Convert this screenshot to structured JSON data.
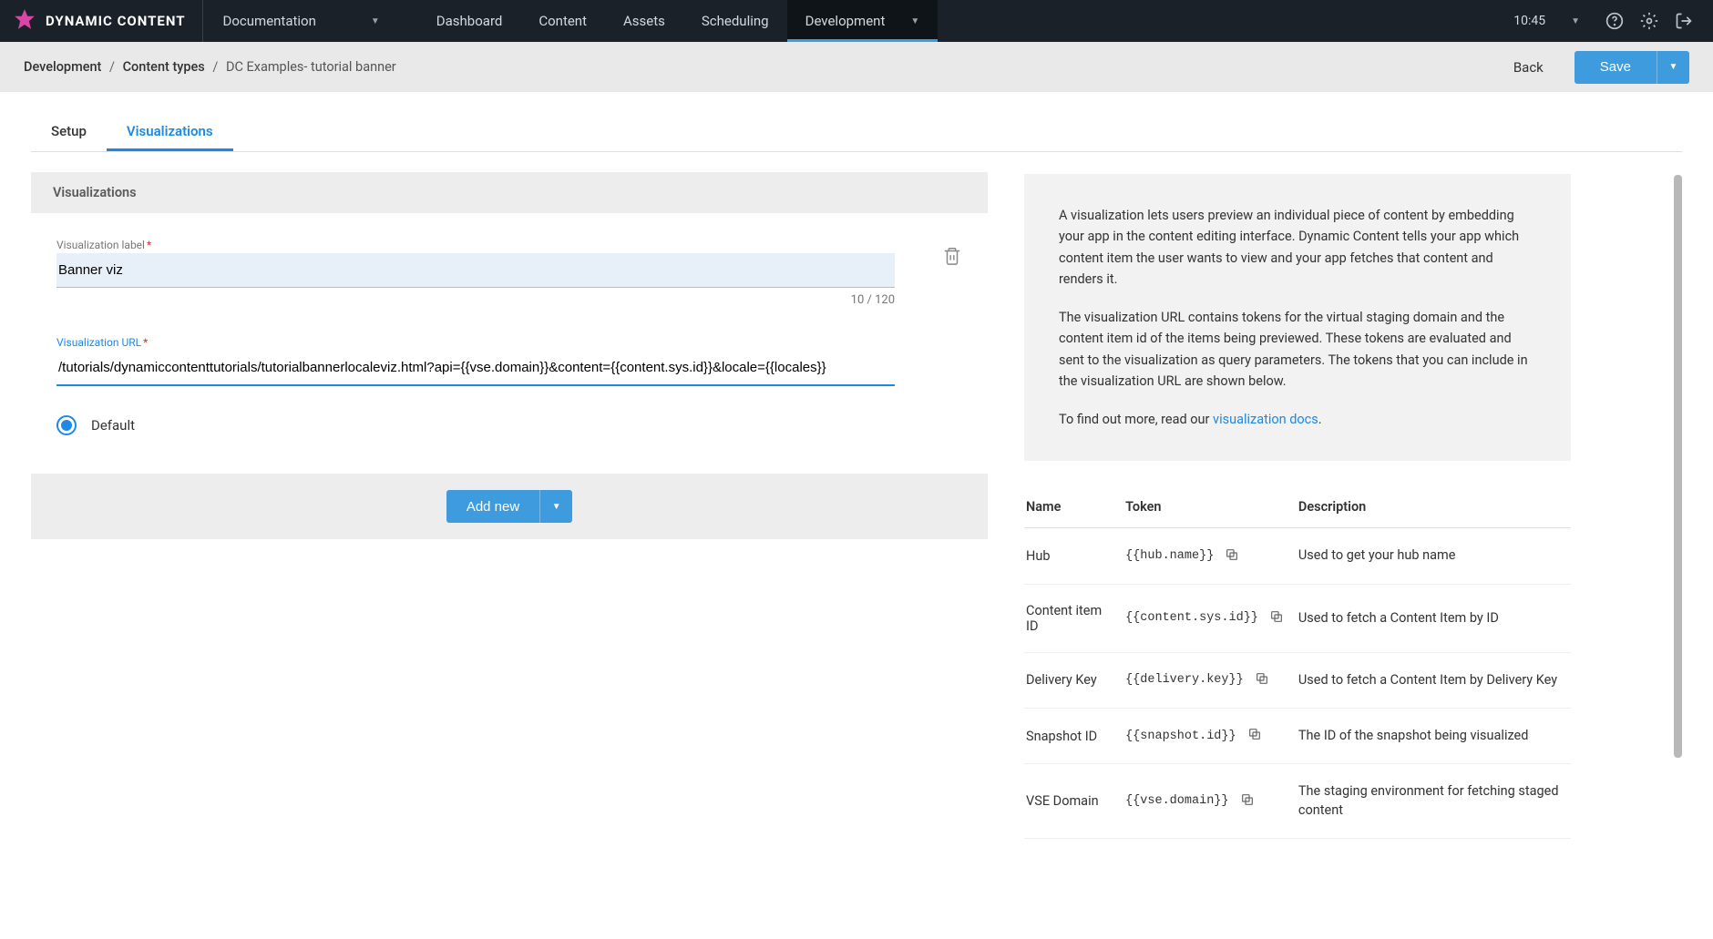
{
  "brand": "DYNAMIC CONTENT",
  "topnav": {
    "documentation_label": "Documentation",
    "tabs": [
      "Dashboard",
      "Content",
      "Assets",
      "Scheduling",
      "Development"
    ],
    "active_tab": "Development",
    "time": "10:45"
  },
  "subheader": {
    "crumb1": "Development",
    "crumb2": "Content types",
    "crumb3": "DC Examples- tutorial banner",
    "back_label": "Back",
    "save_label": "Save"
  },
  "page_tabs": {
    "setup_label": "Setup",
    "viz_label": "Visualizations"
  },
  "panel": {
    "header": "Visualizations",
    "label_field_label": "Visualization label",
    "label_value": "Banner viz",
    "label_count": "10 / 120",
    "url_field_label": "Visualization URL",
    "url_value": "/tutorials/dynamiccontenttutorials/tutorialbannerlocaleviz.html?api={{vse.domain}}&content={{content.sys.id}}&locale={{locales}}",
    "default_radio_label": "Default",
    "add_new_label": "Add new"
  },
  "info": {
    "p1": "A visualization lets users preview an individual piece of content by embedding your app in the content editing interface. Dynamic Content tells your app which content item the user wants to view and your app fetches that content and renders it.",
    "p2": "The visualization URL contains tokens for the virtual staging domain and the content item id of the items being previewed. These tokens are evaluated and sent to the visualization as query parameters. The tokens that you can include in the visualization URL are shown below.",
    "p3_prefix": "To find out more, read our ",
    "p3_link": "visualization docs",
    "p3_suffix": "."
  },
  "token_table": {
    "col_name": "Name",
    "col_token": "Token",
    "col_desc": "Description",
    "rows": [
      {
        "name": "Hub",
        "token": "{{hub.name}}",
        "desc": "Used to get your hub name"
      },
      {
        "name": "Content item ID",
        "token": "{{content.sys.id}}",
        "desc": "Used to fetch a Content Item by ID"
      },
      {
        "name": "Delivery Key",
        "token": "{{delivery.key}}",
        "desc": "Used to fetch a Content Item by Delivery Key"
      },
      {
        "name": "Snapshot ID",
        "token": "{{snapshot.id}}",
        "desc": "The ID of the snapshot being visualized"
      },
      {
        "name": "VSE Domain",
        "token": "{{vse.domain}}",
        "desc": "The staging environment for fetching staged content"
      }
    ]
  }
}
